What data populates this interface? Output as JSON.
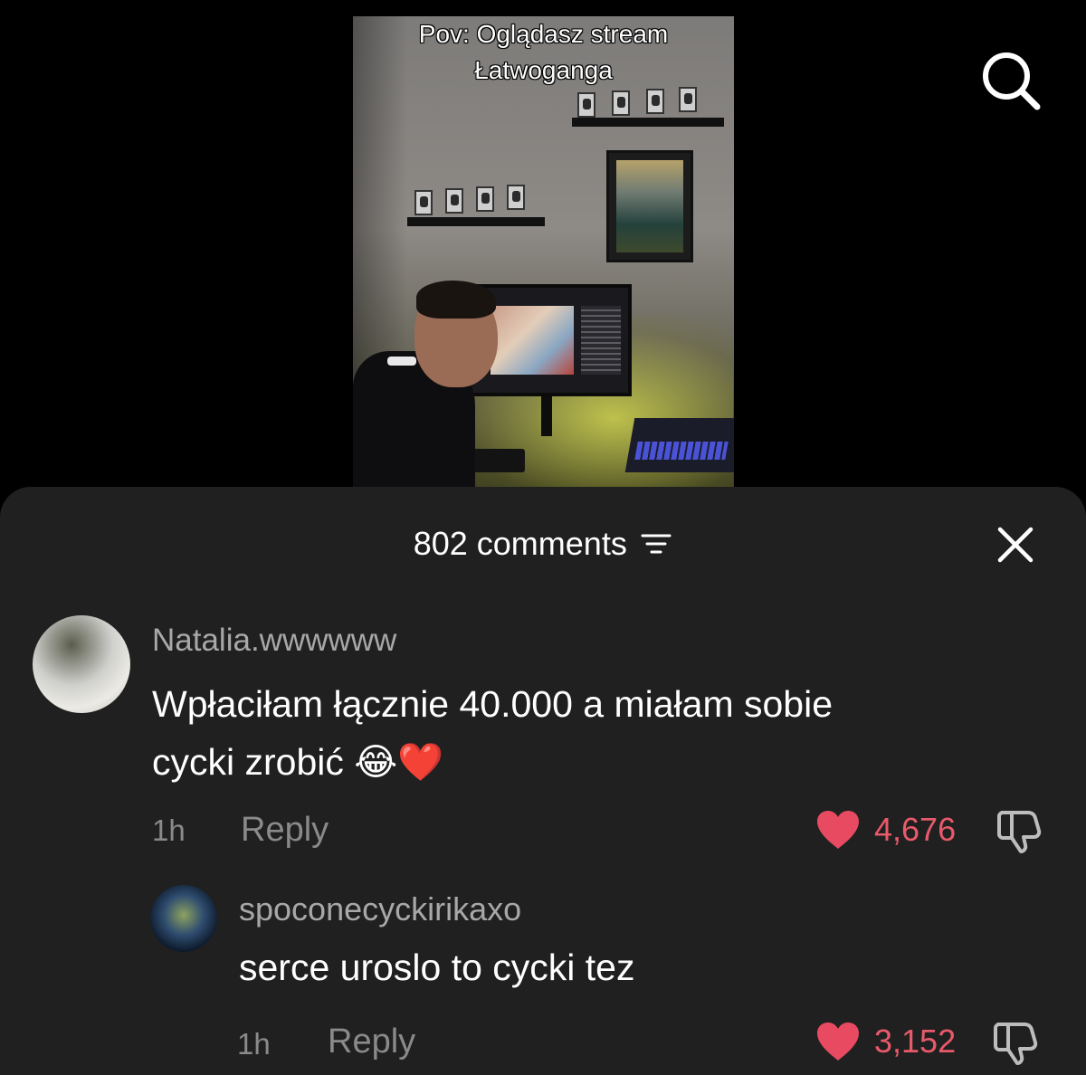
{
  "video": {
    "caption_line1": "Pov: Oglądasz stream",
    "caption_line2": "Łatwoganga"
  },
  "top_bar": {
    "search_icon": "search-icon"
  },
  "comments_sheet": {
    "count_label": "802 comments",
    "filter_icon": "sort-filter-icon",
    "close_icon": "close-icon",
    "accent_like_color": "#e85a6b",
    "comments": [
      {
        "username": "Natalia.wwwwww",
        "text_line1": "Wpłaciłam łącznie 40.000 a miałam sobie",
        "text_line2": "cycki zrobić 😂❤️",
        "time": "1h",
        "reply_label": "Reply",
        "likes": "4,676",
        "like_icon": "heart-icon",
        "dislike_icon": "thumbs-down-icon"
      },
      {
        "username": "spoconecyckirikaxo",
        "text": "serce uroslo to cycki tez",
        "time": "1h",
        "reply_label": "Reply",
        "likes": "3,152",
        "like_icon": "heart-icon",
        "dislike_icon": "thumbs-down-icon"
      }
    ]
  }
}
